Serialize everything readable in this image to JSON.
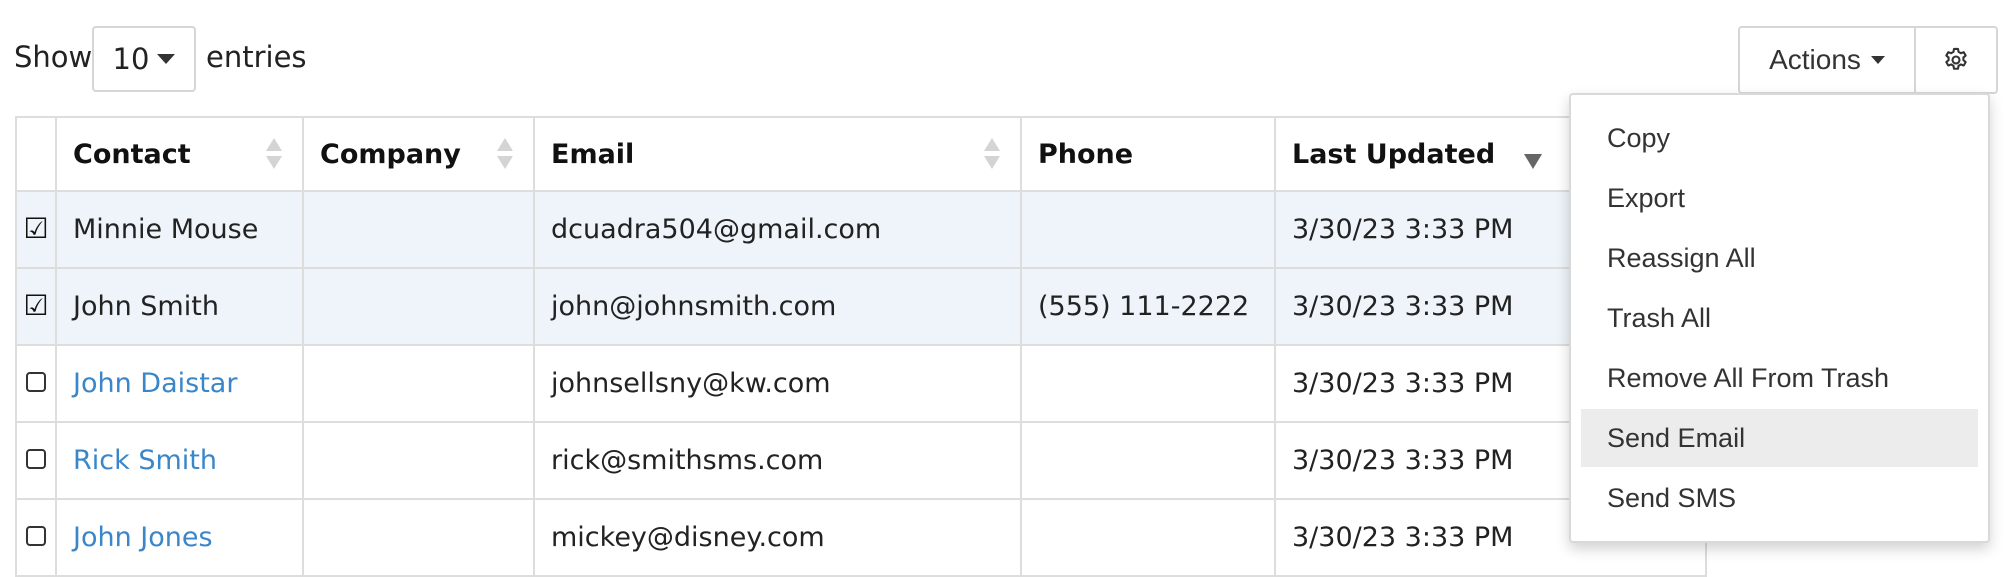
{
  "length_control": {
    "show_label": "Show",
    "selected_value": "10",
    "entries_label": "entries"
  },
  "toolbar": {
    "actions_label": "Actions",
    "settings_icon": "gear-icon"
  },
  "table": {
    "columns": [
      "Contact",
      "Company",
      "Email",
      "Phone",
      "Last Updated"
    ],
    "rows": [
      {
        "checked": true,
        "contact": "Minnie Mouse",
        "company": "",
        "email": "dcuadra504@gmail.com",
        "phone": "",
        "updated": "3/30/23 3:33 PM"
      },
      {
        "checked": true,
        "contact": "John Smith",
        "company": "",
        "email": "john@johnsmith.com",
        "phone": "(555) 111-2222",
        "updated": "3/30/23 3:33 PM"
      },
      {
        "checked": false,
        "contact": "John Daistar",
        "company": "",
        "email": "johnsellsny@kw.com",
        "phone": "",
        "updated": "3/30/23 3:33 PM"
      },
      {
        "checked": false,
        "contact": "Rick Smith",
        "company": "",
        "email": "rick@smithsms.com",
        "phone": "",
        "updated": "3/30/23 3:33 PM"
      },
      {
        "checked": false,
        "contact": "John Jones",
        "company": "",
        "email": "mickey@disney.com",
        "phone": "",
        "updated": "3/30/23 3:33 PM"
      }
    ]
  },
  "actions_menu": {
    "items": [
      "Copy",
      "Export",
      "Reassign All",
      "Trash All",
      "Remove All From Trash",
      "Send Email",
      "Send SMS"
    ],
    "active": "Send Email"
  },
  "colors": {
    "link": "#3a86c8",
    "selected_row_bg": "#eef4f9",
    "menu_active_bg": "#ececec"
  }
}
